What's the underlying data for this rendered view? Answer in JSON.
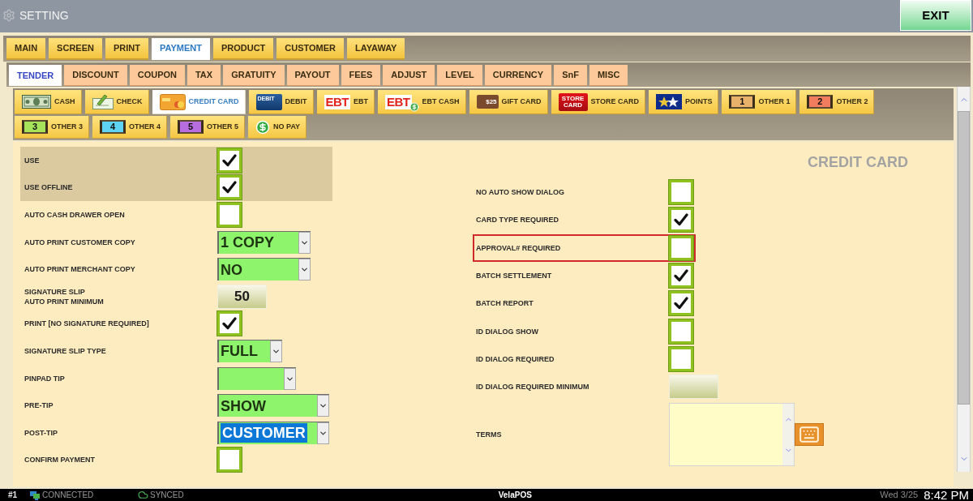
{
  "window": {
    "title": "SETTING"
  },
  "exit_button": {
    "label": "EXIT"
  },
  "main_tabs": [
    {
      "label": "MAIN",
      "selected": false
    },
    {
      "label": "SCREEN",
      "selected": false
    },
    {
      "label": "PRINT",
      "selected": false
    },
    {
      "label": "PAYMENT",
      "selected": true
    },
    {
      "label": "PRODUCT",
      "selected": false
    },
    {
      "label": "CUSTOMER",
      "selected": false
    },
    {
      "label": "LAYAWAY",
      "selected": false
    }
  ],
  "sub_tabs": [
    {
      "label": "TENDER",
      "selected": true
    },
    {
      "label": "DISCOUNT",
      "selected": false
    },
    {
      "label": "COUPON",
      "selected": false
    },
    {
      "label": "TAX",
      "selected": false
    },
    {
      "label": "GRATUITY",
      "selected": false
    },
    {
      "label": "PAYOUT",
      "selected": false
    },
    {
      "label": "FEES",
      "selected": false
    },
    {
      "label": "ADJUST",
      "selected": false
    },
    {
      "label": "LEVEL",
      "selected": false
    },
    {
      "label": "CURRENCY",
      "selected": false
    },
    {
      "label": "SnF",
      "selected": false
    },
    {
      "label": "MISC",
      "selected": false
    }
  ],
  "tender_tabs": [
    {
      "label": "CASH",
      "kind": "cash",
      "selected": false
    },
    {
      "label": "CHECK",
      "kind": "check",
      "selected": false
    },
    {
      "label": "CREDIT CARD",
      "kind": "credit",
      "selected": true
    },
    {
      "label": "DEBIT",
      "kind": "debit",
      "icon_text": "DEBIT",
      "selected": false
    },
    {
      "label": "EBT",
      "kind": "ebt",
      "icon_text": "EBT",
      "selected": false
    },
    {
      "label": "EBT CASH",
      "kind": "ebt_cash",
      "icon_text": "EBT",
      "selected": false
    },
    {
      "label": "GIFT CARD",
      "kind": "gift",
      "icon_text": "$25",
      "selected": false
    },
    {
      "label": "STORE CARD",
      "kind": "store",
      "icon_text": "STORE CARD",
      "selected": false
    },
    {
      "label": "POINTS",
      "kind": "points",
      "selected": false
    },
    {
      "label": "OTHER 1",
      "kind": "number",
      "icon_text": "1",
      "color": "#e9b26a",
      "selected": false
    },
    {
      "label": "OTHER 2",
      "kind": "number",
      "icon_text": "2",
      "color": "#f27d5e",
      "selected": false
    },
    {
      "label": "OTHER 3",
      "kind": "number",
      "icon_text": "3",
      "color": "#a6e35a",
      "selected": false
    },
    {
      "label": "OTHER 4",
      "kind": "number",
      "icon_text": "4",
      "color": "#5fd3f3",
      "selected": false
    },
    {
      "label": "OTHER 5",
      "kind": "number",
      "icon_text": "5",
      "color": "#b66de0",
      "selected": false
    },
    {
      "label": "NO PAY",
      "kind": "coin",
      "selected": false
    }
  ],
  "panel": {
    "title": "CREDIT CARD"
  },
  "left_settings": [
    {
      "label": "USE",
      "kind": "checkbox",
      "checked": true,
      "shaded": true
    },
    {
      "label": "USE OFFLINE",
      "kind": "checkbox",
      "checked": true,
      "shaded": true
    },
    {
      "label": "AUTO CASH DRAWER OPEN",
      "kind": "checkbox",
      "checked": false,
      "shaded": false
    },
    {
      "label": "AUTO PRINT CUSTOMER COPY",
      "kind": "dropdown",
      "value": "1 COPY",
      "highlighted": false,
      "shaded": false
    },
    {
      "label": "AUTO PRINT MERCHANT COPY",
      "kind": "dropdown",
      "value": "NO",
      "highlighted": false,
      "shaded": false
    },
    {
      "label": "SIGNATURE SLIP\nAUTO PRINT MINIMUM",
      "kind": "button",
      "value": "50",
      "shaded": false
    },
    {
      "label": "PRINT [NO SIGNATURE REQUIRED]",
      "kind": "checkbox",
      "checked": true,
      "shaded": false
    },
    {
      "label": "SIGNATURE SLIP TYPE",
      "kind": "dropdown",
      "value": "FULL",
      "highlighted": false,
      "shaded": false
    },
    {
      "label": "PINPAD TIP",
      "kind": "dropdown",
      "highlighted": false,
      "shaded": false
    },
    {
      "label": "PRE-TIP",
      "kind": "dropdown",
      "value": "SHOW",
      "highlighted": false,
      "shaded": false
    },
    {
      "label": "POST-TIP",
      "kind": "dropdown",
      "value": "CUSTOMER",
      "highlighted": true,
      "shaded": false
    },
    {
      "label": "CONFIRM PAYMENT",
      "kind": "checkbox",
      "checked": false,
      "shaded": false
    }
  ],
  "right_settings": [
    {
      "label": "NO AUTO SHOW DIALOG",
      "kind": "checkbox",
      "checked": false,
      "outlined": false
    },
    {
      "label": "CARD TYPE REQUIRED",
      "kind": "checkbox",
      "checked": true,
      "outlined": false
    },
    {
      "label": "APPROVAL# REQUIRED",
      "kind": "checkbox",
      "checked": false,
      "outlined": true
    },
    {
      "label": "BATCH SETTLEMENT",
      "kind": "checkbox",
      "checked": true,
      "outlined": false
    },
    {
      "label": "BATCH REPORT",
      "kind": "checkbox",
      "checked": true,
      "outlined": false
    },
    {
      "label": "ID DIALOG SHOW",
      "kind": "checkbox",
      "checked": false,
      "outlined": false
    },
    {
      "label": "ID DIALOG REQUIRED",
      "kind": "checkbox",
      "checked": false,
      "outlined": false
    },
    {
      "label": "ID DIALOG REQUIRED MINIMUM",
      "kind": "button",
      "outlined": false
    },
    {
      "label": "TERMS",
      "kind": "textarea",
      "outlined": false
    }
  ],
  "status_bar": {
    "terminal": "#1",
    "connection": "CONNECTED",
    "sync": "SYNCED",
    "brand": "VelaPOS",
    "date": "Wed 3/25",
    "time": "8:42 PM"
  }
}
